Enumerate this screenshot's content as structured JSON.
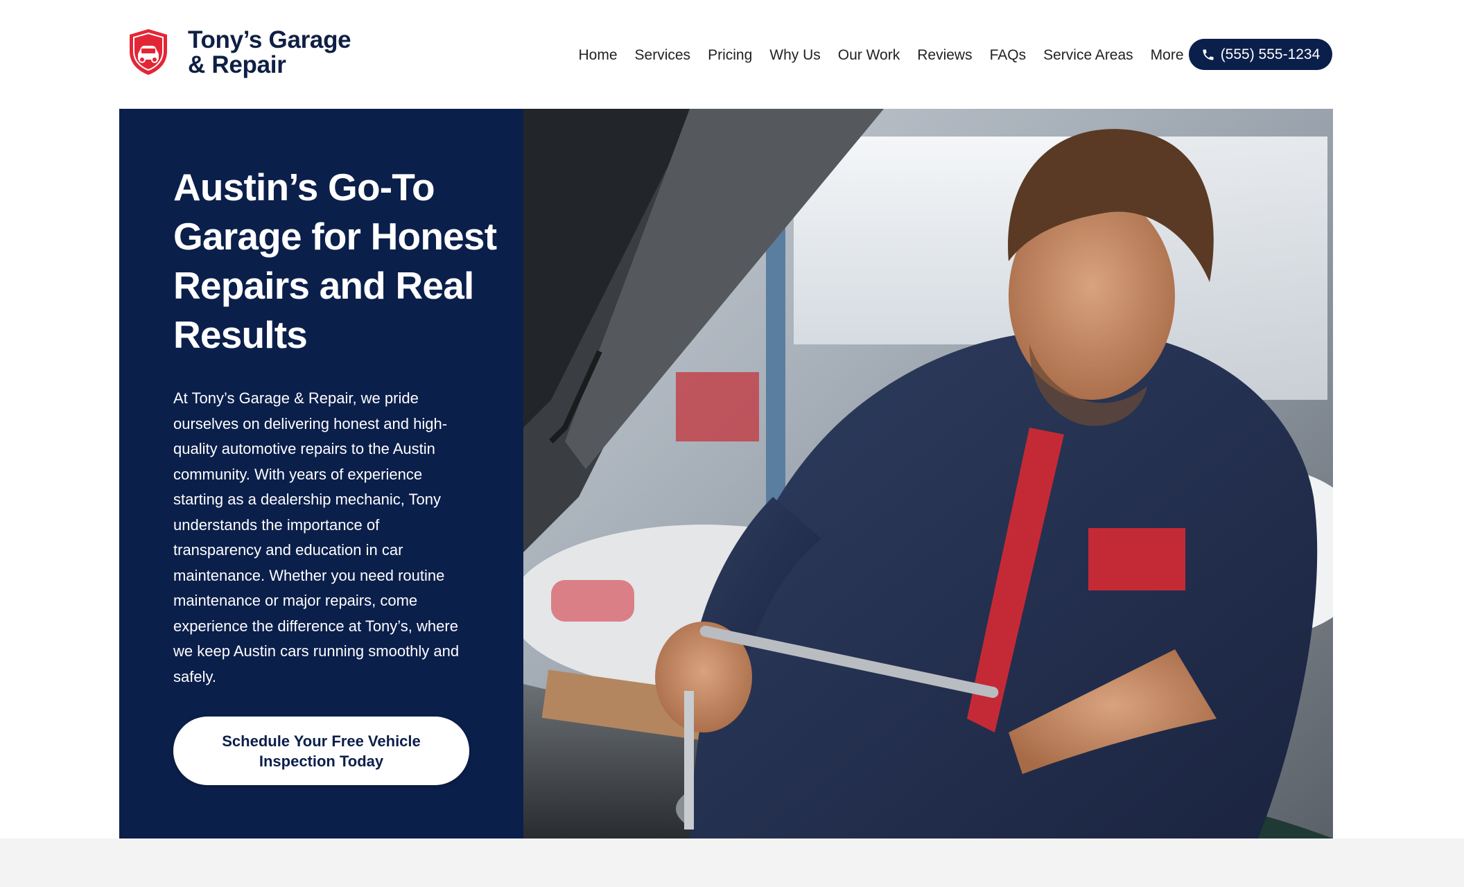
{
  "brand": {
    "name": "Tony’s Garage & Repair",
    "accent_color": "#e32636",
    "navy_color": "#0b1f4b",
    "logo_icon": "shield-car-icon"
  },
  "nav": {
    "items": [
      {
        "label": "Home"
      },
      {
        "label": "Services"
      },
      {
        "label": "Pricing"
      },
      {
        "label": "Why Us"
      },
      {
        "label": "Our Work"
      },
      {
        "label": "Reviews"
      },
      {
        "label": "FAQs"
      },
      {
        "label": "Service Areas"
      },
      {
        "label": "More"
      }
    ],
    "phone": {
      "label": "(555) 555-1234",
      "icon": "phone-icon"
    }
  },
  "hero": {
    "title": "Austin’s Go-To Garage for Honest Repairs and Real Results",
    "description": "At Tony’s Garage & Repair, we pride ourselves on delivering honest and high-quality automotive repairs to the Austin community. With years of experience starting as a dealership mechanic, Tony understands the importance of transparency and education in car maintenance. Whether you need routine maintenance or major repairs, come experience the difference at Tony’s, where we keep Austin cars running smoothly and safely.",
    "cta_label": "Schedule Your Free Vehicle Inspection Today",
    "image_subject": "mechanic-working-under-car-hood"
  }
}
